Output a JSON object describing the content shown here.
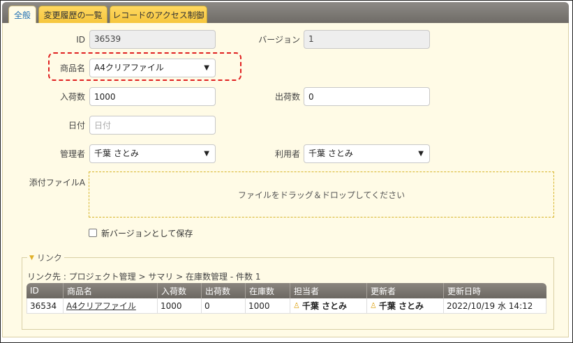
{
  "tabs": [
    {
      "label": "全般"
    },
    {
      "label": "変更履歴の一覧"
    },
    {
      "label": "レコードのアクセス制御"
    }
  ],
  "form": {
    "id_label": "ID",
    "id_value": "36539",
    "version_label": "バージョン",
    "version_value": "1",
    "product_label": "商品名",
    "product_value": "A4クリアファイル",
    "in_label": "入荷数",
    "in_value": "1000",
    "out_label": "出荷数",
    "out_value": "0",
    "date_label": "日付",
    "date_placeholder": "日付",
    "manager_label": "管理者",
    "manager_value": "千葉 さとみ",
    "user_label": "利用者",
    "user_value": "千葉 さとみ",
    "attach_label": "添付ファイルA",
    "attach_drop": "ファイルをドラッグ＆ドロップしてください",
    "new_version_label": "新バージョンとして保存"
  },
  "links": {
    "legend": "リンク",
    "path": "リンク先 : プロジェクト管理 > サマリ > 在庫数管理 - 件数 1",
    "columns": [
      "ID",
      "商品名",
      "入荷数",
      "出荷数",
      "在庫数",
      "担当者",
      "更新者",
      "更新日時"
    ],
    "rows": [
      {
        "id": "36534",
        "product": "A4クリアファイル",
        "in": "1000",
        "out": "0",
        "stock": "1000",
        "owner": "千葉 さとみ",
        "updater": "千葉 さとみ",
        "updated": "2022/10/19 水 14:12"
      }
    ]
  },
  "icons": {
    "dropdown": "chevron-down-icon",
    "collapse": "triangle-down-icon",
    "user": "user-icon"
  },
  "colors": {
    "tab_active_text": "#1f6fb3",
    "tab_bg": "#f6c63d",
    "panel_bg": "#fffbe6",
    "highlight": "#e02020",
    "table_header": "#6c6862"
  }
}
